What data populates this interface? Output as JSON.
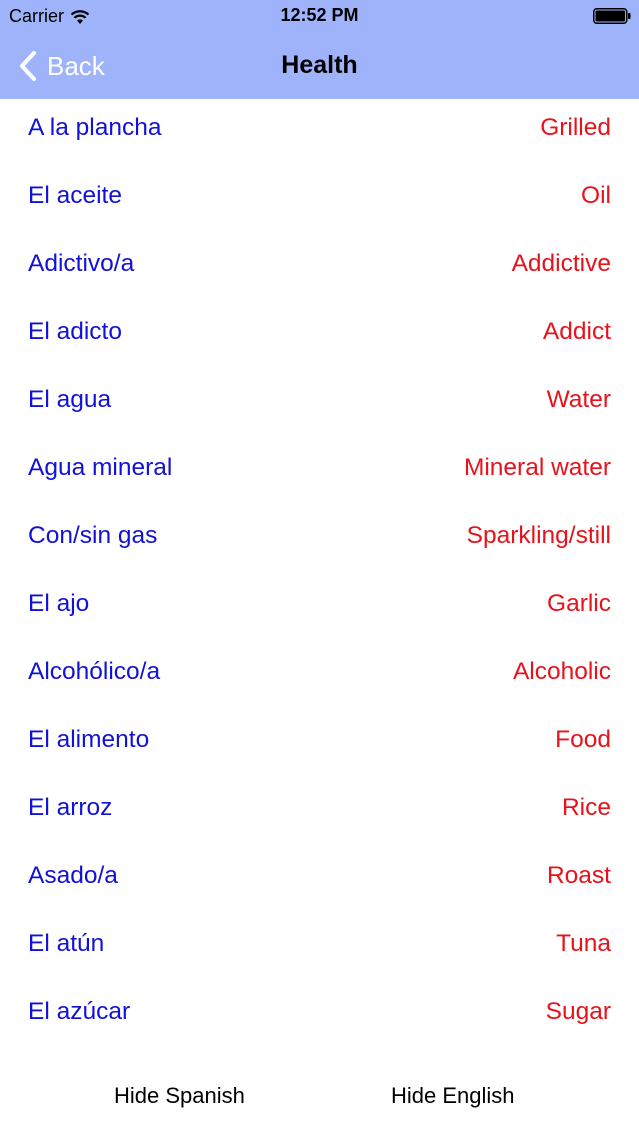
{
  "status_bar": {
    "carrier": "Carrier",
    "time": "12:52 PM",
    "icons": [
      "wifi-icon",
      "battery-icon"
    ]
  },
  "nav": {
    "back_label": "Back",
    "title": "Health",
    "back_icon": "chevron-left-icon",
    "bar_color": "#9fb3fb"
  },
  "colors": {
    "spanish": "#1111d8",
    "english": "#e8121b"
  },
  "words": [
    {
      "es": "A la plancha",
      "en": "Grilled"
    },
    {
      "es": "El aceite",
      "en": "Oil"
    },
    {
      "es": "Adictivo/a",
      "en": "Addictive"
    },
    {
      "es": "El adicto",
      "en": "Addict"
    },
    {
      "es": "El agua",
      "en": "Water"
    },
    {
      "es": "Agua mineral",
      "en": "Mineral water"
    },
    {
      "es": "Con/sin gas",
      "en": "Sparkling/still"
    },
    {
      "es": "El ajo",
      "en": "Garlic"
    },
    {
      "es": "Alcohólico/a",
      "en": "Alcoholic"
    },
    {
      "es": "El alimento",
      "en": "Food"
    },
    {
      "es": "El arroz",
      "en": "Rice"
    },
    {
      "es": "Asado/a",
      "en": "Roast"
    },
    {
      "es": "El atún",
      "en": "Tuna"
    },
    {
      "es": "El azúcar",
      "en": "Sugar"
    }
  ],
  "footer": {
    "hide_spanish": "Hide Spanish",
    "hide_english": "Hide English"
  }
}
